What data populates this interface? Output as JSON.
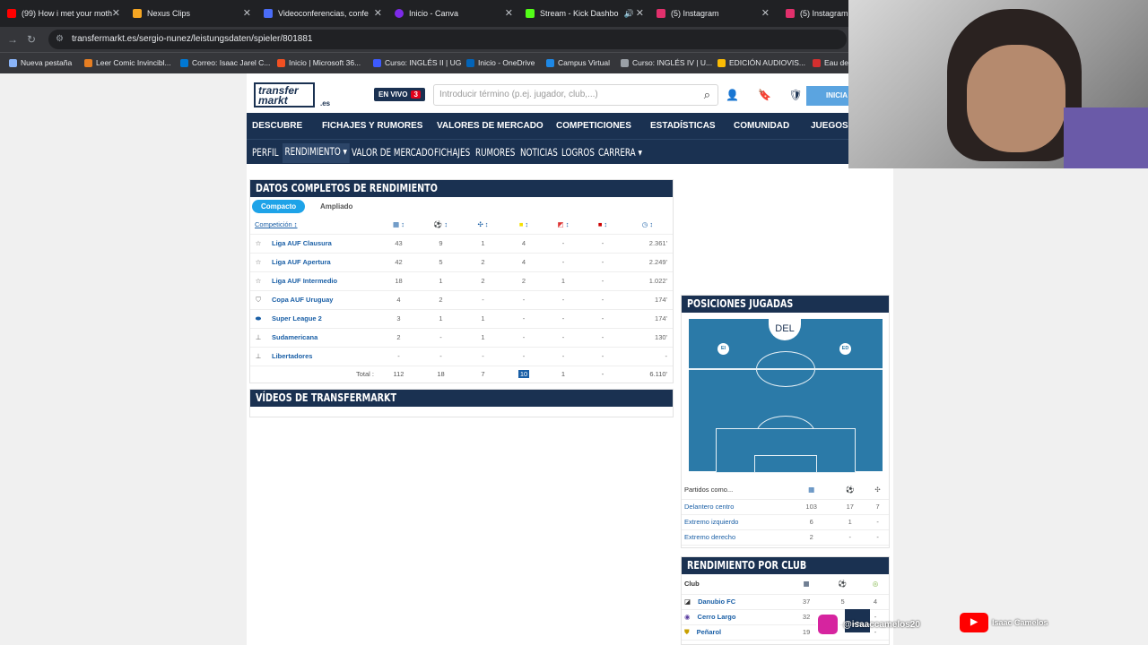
{
  "browser": {
    "tabs": [
      {
        "label": "(99) How i met your moth",
        "color": "#ff0000"
      },
      {
        "label": "Nexus Clips",
        "color": "#f5a623"
      },
      {
        "label": "Videoconferencias, confe",
        "color": "#4a6cf7"
      },
      {
        "label": "Inicio - Canva",
        "color": "#7d2ae8"
      },
      {
        "label": "Stream - Kick Dashbo",
        "color": "#53fc18"
      },
      {
        "label": "(5) Instagram",
        "color": "#e1306c"
      },
      {
        "label": "(5) Instagram",
        "color": "#e1306c"
      }
    ],
    "url": "transfermarkt.es/sergio-nunez/leistungsdaten/spieler/801881",
    "bookmarks": [
      {
        "label": "Nueva pestaña",
        "color": "#8ab4f8"
      },
      {
        "label": "Leer Comic Invincibl...",
        "color": "#e67e22"
      },
      {
        "label": "Correo: Isaac Jarel C...",
        "color": "#0078d4"
      },
      {
        "label": "Inicio | Microsoft 36...",
        "color": "#f25022"
      },
      {
        "label": "Curso: INGLÉS II | UG",
        "color": "#3d5afe"
      },
      {
        "label": "Inicio - OneDrive",
        "color": "#0364b8"
      },
      {
        "label": "Campus Virtual",
        "color": "#1e88e5"
      },
      {
        "label": "Curso: INGLÉS IV | U...",
        "color": "#9aa0a6"
      },
      {
        "label": "EDICIÓN AUDIOVIS...",
        "color": "#fbbc04"
      },
      {
        "label": "Eau de",
        "color": "#d32f2f"
      }
    ]
  },
  "header": {
    "logo": "transfer markt",
    "domain": ".es",
    "live_label": "EN VIVO",
    "live_count": "3",
    "search_placeholder": "Introducir término (p.ej. jugador, club,...)",
    "login_label": "INICIA"
  },
  "main_nav": [
    "DESCUBRE",
    "FICHAJES Y RUMORES",
    "VALORES DE MERCADO",
    "COMPETICIONES",
    "ESTADÍSTICAS",
    "COMUNIDAD",
    "JUEGOS"
  ],
  "sub_nav": [
    "PERFIL",
    "RENDIMIENTO ▾",
    "VALOR DE MERCADO",
    "FICHAJES",
    "RUMORES",
    "NOTICIAS",
    "LOGROS",
    "CARRERA ▾"
  ],
  "performance": {
    "title": "DATOS COMPLETOS DE RENDIMIENTO",
    "tab_compact": "Compacto",
    "tab_extended": "Ampliado",
    "col_competition": "Competición ↕",
    "rows": [
      {
        "comp": "Liga AUF Clausura",
        "v": [
          "43",
          "9",
          "1",
          "4",
          "-",
          "-",
          "2.361'"
        ]
      },
      {
        "comp": "Liga AUF Apertura",
        "v": [
          "42",
          "5",
          "2",
          "4",
          "-",
          "-",
          "2.249'"
        ]
      },
      {
        "comp": "Liga AUF Intermedio",
        "v": [
          "18",
          "1",
          "2",
          "2",
          "1",
          "-",
          "1.022'"
        ]
      },
      {
        "comp": "Copa AUF Uruguay",
        "v": [
          "4",
          "2",
          "-",
          "-",
          "-",
          "-",
          "174'"
        ]
      },
      {
        "comp": "Super League 2",
        "v": [
          "3",
          "1",
          "1",
          "-",
          "-",
          "-",
          "174'"
        ]
      },
      {
        "comp": "Sudamericana",
        "v": [
          "2",
          "-",
          "1",
          "-",
          "-",
          "-",
          "130'"
        ]
      },
      {
        "comp": "Libertadores",
        "v": [
          "-",
          "-",
          "-",
          "-",
          "-",
          "-",
          "-"
        ]
      }
    ],
    "total_label": "Total :",
    "totals": [
      "112",
      "18",
      "7",
      "10",
      "1",
      "-",
      "6.110'"
    ]
  },
  "videos_title": "VÍDEOS DE TRANSFERMARKT",
  "positions": {
    "title": "POSICIONES JUGADAS",
    "main_position": "DEL",
    "badge_left": "EI",
    "badge_right": "ED",
    "played_as": "Partidos como...",
    "rows": [
      {
        "pos": "Delantero centro",
        "v": [
          "103",
          "17",
          "7"
        ]
      },
      {
        "pos": "Extremo izquierdo",
        "v": [
          "6",
          "1",
          "-"
        ]
      },
      {
        "pos": "Extremo derecho",
        "v": [
          "2",
          "-",
          "-"
        ]
      }
    ]
  },
  "club_perf": {
    "title": "RENDIMIENTO POR CLUB",
    "club_label": "Club",
    "rows": [
      {
        "club": "Danubio FC",
        "v": [
          "37",
          "5",
          "4"
        ]
      },
      {
        "club": "Cerro Largo",
        "v": [
          "32",
          "",
          "-"
        ]
      },
      {
        "club": "Peñarol",
        "v": [
          "19",
          "",
          "-"
        ]
      }
    ]
  },
  "overlays": {
    "instagram": "@isaaccamelos20",
    "youtube": "Isaac Camelos"
  }
}
